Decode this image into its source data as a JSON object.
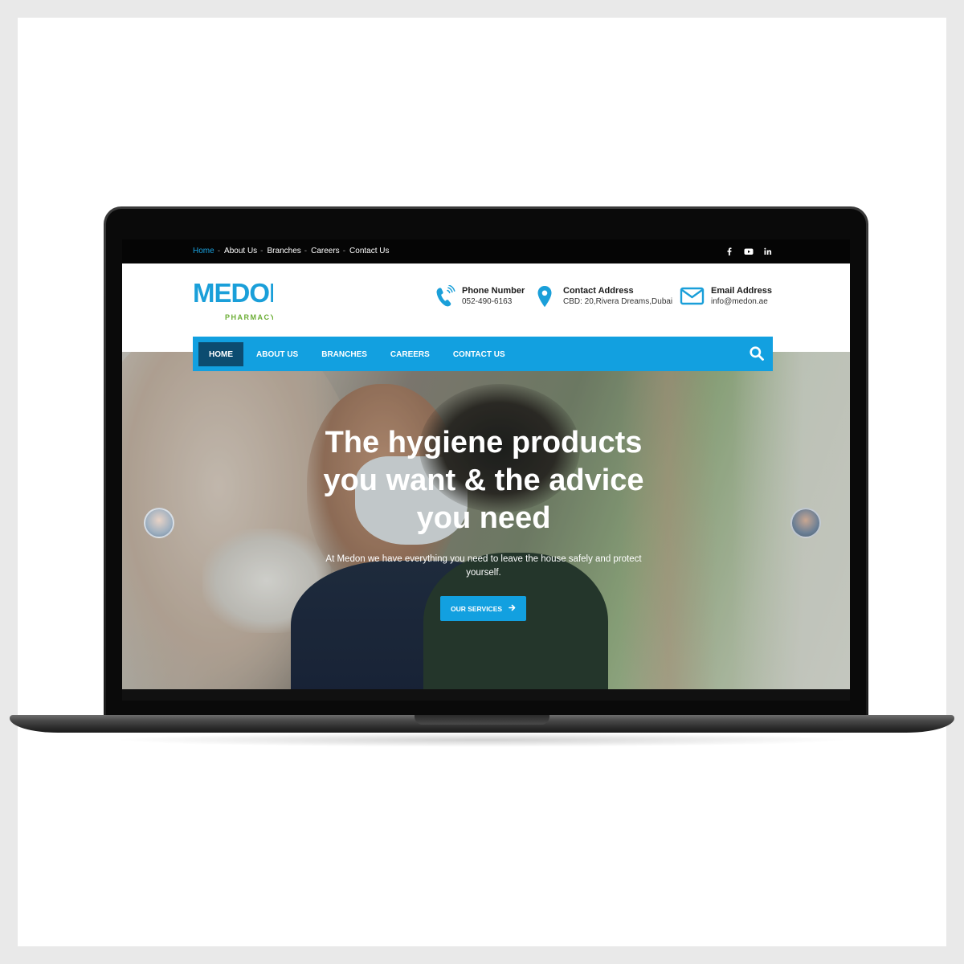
{
  "topbar": {
    "links": [
      {
        "label": "Home",
        "active": true
      },
      {
        "label": "About Us",
        "active": false
      },
      {
        "label": "Branches",
        "active": false
      },
      {
        "label": "Careers",
        "active": false
      },
      {
        "label": "Contact Us",
        "active": false
      }
    ],
    "separator": "-",
    "social_icons": [
      "facebook-icon",
      "youtube-icon",
      "linkedin-icon"
    ]
  },
  "logo": {
    "word": "MEDON",
    "sub": "PHARMACY"
  },
  "contact": {
    "phone": {
      "title": "Phone Number",
      "value": "052-490-6163",
      "icon": "phone-icon"
    },
    "address": {
      "title": "Contact Address",
      "value": "CBD: 20,Rivera Dreams,Dubai",
      "icon": "location-pin-icon"
    },
    "email": {
      "title": "Email Address",
      "value": "info@medon.ae",
      "icon": "envelope-icon"
    }
  },
  "nav": {
    "items": [
      {
        "label": "HOME",
        "active": true
      },
      {
        "label": "ABOUT US",
        "active": false
      },
      {
        "label": "BRANCHES",
        "active": false
      },
      {
        "label": "CAREERS",
        "active": false
      },
      {
        "label": "CONTACT US",
        "active": false
      }
    ],
    "search_icon": "search-icon"
  },
  "hero": {
    "title_lines": [
      "The hygiene products",
      "you want & the advice",
      "you need"
    ],
    "text_lines": [
      "At Medon we have everything you need to leave the house safely and protect",
      "yourself."
    ],
    "button_label": "OUR SERVICES",
    "button_icon": "arrow-right-icon"
  },
  "colors": {
    "accent": "#12a0e0",
    "nav_active": "#0c4c70",
    "logo_blue": "#1a9fd9",
    "logo_green": "#6cae36",
    "topbar": "#050505"
  }
}
